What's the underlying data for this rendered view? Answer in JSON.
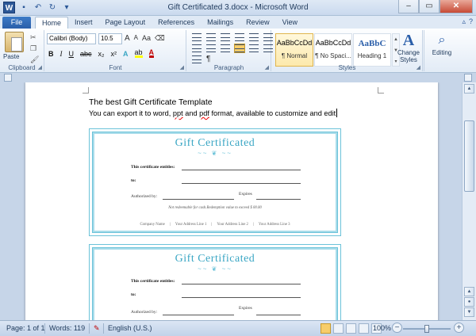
{
  "window": {
    "title": "Gift Certificated 3.docx - Microsoft Word",
    "app_icon": "W",
    "minimize": "–",
    "maximize": "▭",
    "close": "✕"
  },
  "tabs": {
    "file": "File",
    "items": [
      "Home",
      "Insert",
      "Page Layout",
      "References",
      "Mailings",
      "Review",
      "View"
    ],
    "active": "Home"
  },
  "ribbon": {
    "clipboard": {
      "label": "Clipboard",
      "paste": "Paste"
    },
    "font": {
      "label": "Font",
      "name": "Calibri (Body)",
      "size": "10.5",
      "grow": "A",
      "shrink": "A",
      "case": "Aa",
      "clear": "⌫",
      "bold": "B",
      "italic": "I",
      "underline": "U",
      "strike": "abc",
      "sub": "x₂",
      "sup": "x²",
      "effects": "A",
      "highlight": "ab",
      "color": "A"
    },
    "paragraph": {
      "label": "Paragraph",
      "pilcrow": "¶"
    },
    "styles": {
      "label": "Styles",
      "items": [
        {
          "sample": "AaBbCcDd",
          "name": "¶ Normal"
        },
        {
          "sample": "AaBbCcDd",
          "name": "¶ No Spaci..."
        },
        {
          "sample": "AaBbC",
          "name": "Heading 1"
        }
      ],
      "change_styles": "Change Styles"
    },
    "editing": {
      "label": "Editing"
    }
  },
  "document": {
    "line1": "The best Gift Certificate Template",
    "line2_pre": "You can export it to word, ",
    "line2_ppt": "ppt",
    "line2_mid": " and ",
    "line2_pdf": "pdf",
    "line2_post": " format, available to customize and edit",
    "certificates": [
      {
        "title": "Gift Certificated",
        "deco": "~~ ❦ ~~",
        "entitles": "This certificate entitles:",
        "to": "to:",
        "authorized": "Authorized by:",
        "expires": "Expires",
        "note": "Not redeemable for cash.Redemption value to exceed $ 00.00",
        "footer": [
          "Company Name",
          "Your Address Line 1",
          "Your Address Line 2",
          "Your Address Line 3"
        ]
      },
      {
        "title": "Gift Certificated",
        "deco": "~~ ❦ ~~",
        "entitles": "This certificate entitles:",
        "to": "to:",
        "authorized": "Authorized by:",
        "expires": "Expires"
      }
    ]
  },
  "statusbar": {
    "page": "Page: 1 of 1",
    "words": "Words: 119",
    "language": "English (U.S.)",
    "zoom": "100%",
    "zoom_minus": "−",
    "zoom_plus": "+"
  }
}
